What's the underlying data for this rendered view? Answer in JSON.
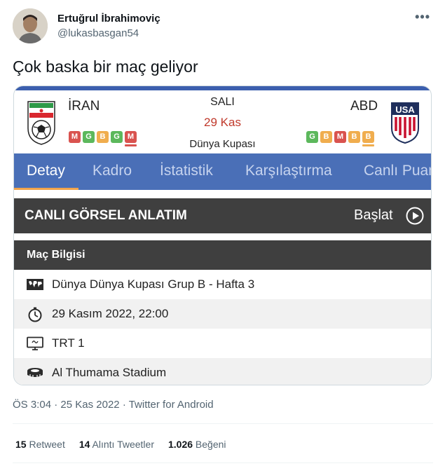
{
  "author": {
    "display_name": "Ertuğrul İbrahimoviç",
    "handle": "@lukasbasgan54"
  },
  "tweet": {
    "text": "Çok baska bir maç geliyor"
  },
  "match": {
    "home_team": "İRAN",
    "away_team": "ABD",
    "day": "SALI",
    "date": "29 Kas",
    "competition": "Dünya Kupası",
    "home_form": [
      {
        "result": "M",
        "color": "#d9534f"
      },
      {
        "result": "G",
        "color": "#5cb85c"
      },
      {
        "result": "B",
        "color": "#f0ad4e"
      },
      {
        "result": "G",
        "color": "#5cb85c"
      },
      {
        "result": "M",
        "color": "#d9534f"
      }
    ],
    "away_form": [
      {
        "result": "G",
        "color": "#5cb85c"
      },
      {
        "result": "B",
        "color": "#f0ad4e"
      },
      {
        "result": "M",
        "color": "#d9534f"
      },
      {
        "result": "B",
        "color": "#f0ad4e"
      },
      {
        "result": "B",
        "color": "#f0ad4e"
      }
    ]
  },
  "tabs": [
    "Detay",
    "Kadro",
    "İstatistik",
    "Karşılaştırma",
    "Canlı Puan"
  ],
  "live": {
    "title": "CANLI GÖRSEL ANLATIM",
    "start_label": "Başlat"
  },
  "info": {
    "title": "Maç Bilgisi",
    "rows": [
      {
        "icon": "world-map-icon",
        "text": "Dünya Dünya Kupası Grup B - Hafta 3"
      },
      {
        "icon": "stopwatch-icon",
        "text": "29 Kasım 2022, 22:00"
      },
      {
        "icon": "tv-icon",
        "text": "TRT 1"
      },
      {
        "icon": "stadium-icon",
        "text": "Al Thumama Stadium"
      }
    ]
  },
  "meta": {
    "time": "ÖS 3:04",
    "date": "25 Kas 2022",
    "client": "Twitter for Android",
    "separator": "·"
  },
  "stats": {
    "retweets": {
      "count": "15",
      "label": "Retweet"
    },
    "quotes": {
      "count": "14",
      "label": "Alıntı Tweetler"
    },
    "likes": {
      "count": "1.026",
      "label": "Beğeni"
    }
  },
  "colors": {
    "accent_blue": "#4a6fb7",
    "dark_bar": "#3f3f3f",
    "date_red": "#c0392b",
    "tab_underline": "#f2a44b"
  }
}
